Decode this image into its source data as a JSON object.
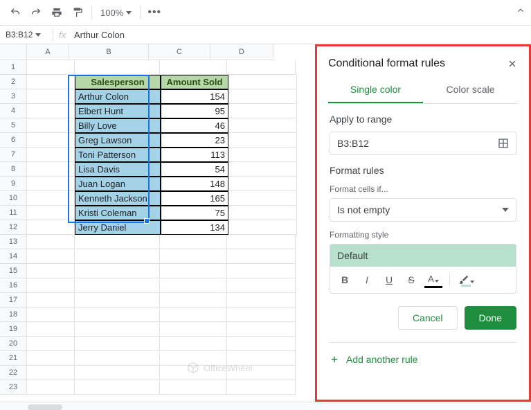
{
  "toolbar": {
    "zoom": "100%"
  },
  "nameBox": "B3:B12",
  "formula": "Arthur Colon",
  "columns": [
    "A",
    "B",
    "C",
    "D"
  ],
  "rowCount": 23,
  "headers": {
    "b": "Salesperson",
    "c": "Amount Sold"
  },
  "dataRows": [
    {
      "b": "Arthur Colon",
      "c": "154"
    },
    {
      "b": "Elbert Hunt",
      "c": "95"
    },
    {
      "b": "Billy Love",
      "c": "46"
    },
    {
      "b": "Greg Lawson",
      "c": "23"
    },
    {
      "b": "Toni Patterson",
      "c": "113"
    },
    {
      "b": "Lisa Davis",
      "c": "54"
    },
    {
      "b": "Juan Logan",
      "c": "148"
    },
    {
      "b": "Kenneth Jackson",
      "c": "165"
    },
    {
      "b": "Kristi Coleman",
      "c": "75"
    },
    {
      "b": "Jerry Daniel",
      "c": "134"
    }
  ],
  "watermark": "OfficeWheel",
  "panel": {
    "title": "Conditional format rules",
    "tabs": {
      "single": "Single color",
      "scale": "Color scale"
    },
    "applyLabel": "Apply to range",
    "range": "B3:B12",
    "rulesLabel": "Format rules",
    "cellsIf": "Format cells if...",
    "condition": "Is not empty",
    "styleLabel": "Formatting style",
    "stylePreview": "Default",
    "cancel": "Cancel",
    "done": "Done",
    "addRule": "Add another rule"
  }
}
